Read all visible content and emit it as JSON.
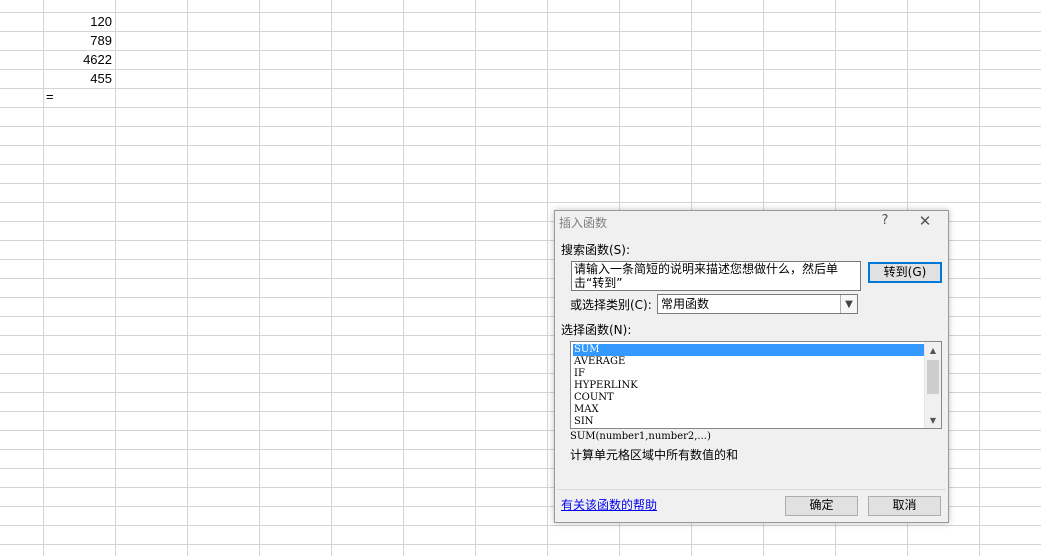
{
  "sheet": {
    "cells": [
      "120",
      "789",
      "4622",
      "455"
    ],
    "formula_cell": "="
  },
  "dialog": {
    "title": "插入函数",
    "help_icon": "?",
    "close_icon": "✕",
    "search_label": "搜索函数(S):",
    "search_value": "请输入一条简短的说明来描述您想做什么，然后单击“转到”",
    "goto_button": "转到(G)",
    "category_label": "或选择类别(C):",
    "category_value": "常用函数",
    "function_label": "选择函数(N):",
    "functions": [
      "SUM",
      "AVERAGE",
      "IF",
      "HYPERLINK",
      "COUNT",
      "MAX",
      "SIN"
    ],
    "selected_function": "SUM",
    "syntax": "SUM(number1,number2,...)",
    "description": "计算单元格区域中所有数值的和",
    "help_link": "有关该函数的帮助",
    "ok_button": "确定",
    "cancel_button": "取消"
  }
}
